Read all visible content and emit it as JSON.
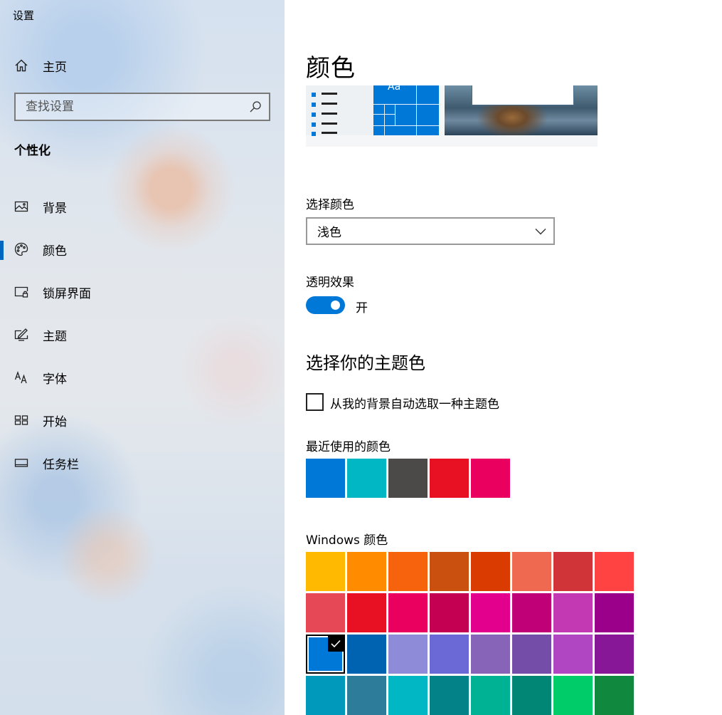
{
  "app": {
    "title": "设置"
  },
  "sidebar": {
    "home_label": "主页",
    "search_placeholder": "查找设置",
    "section_title": "个性化",
    "items": [
      {
        "label": "背景",
        "icon": "picture-icon",
        "active": false
      },
      {
        "label": "颜色",
        "icon": "palette-icon",
        "active": true
      },
      {
        "label": "锁屏界面",
        "icon": "lock-screen-icon",
        "active": false
      },
      {
        "label": "主题",
        "icon": "theme-brush-icon",
        "active": false
      },
      {
        "label": "字体",
        "icon": "font-icon",
        "active": false
      },
      {
        "label": "开始",
        "icon": "start-grid-icon",
        "active": false
      },
      {
        "label": "任务栏",
        "icon": "taskbar-icon",
        "active": false
      }
    ]
  },
  "main": {
    "title": "颜色",
    "preview_tile_text": "Aa",
    "choose_color_label": "选择颜色",
    "choose_color_value": "浅色",
    "transparency_label": "透明效果",
    "transparency_state": "开",
    "accent_heading": "选择你的主题色",
    "auto_accent_label": "从我的背景自动选取一种主题色",
    "recent_label": "最近使用的颜色",
    "windows_colors_label": "Windows 颜色"
  },
  "colors": {
    "accent": "#0078d7",
    "recent": [
      "#0078d7",
      "#00b7c3",
      "#4c4a48",
      "#e81123",
      "#ea005e"
    ],
    "windows": [
      "#ffb900",
      "#ff8c00",
      "#f7630c",
      "#ca5010",
      "#da3b01",
      "#ef6950",
      "#d13438",
      "#ff4343",
      "#e74856",
      "#e81123",
      "#ea005e",
      "#c30052",
      "#e3008c",
      "#bf0077",
      "#c239b3",
      "#9a0089",
      "#0078d7",
      "#0063b1",
      "#8e8cd8",
      "#6b69d6",
      "#8764b8",
      "#744da9",
      "#b146c2",
      "#881798",
      "#0099bc",
      "#2d7d9a",
      "#00b7c3",
      "#038387",
      "#00b294",
      "#018574",
      "#00cc6a",
      "#10893e"
    ],
    "selected_windows_index": 16
  }
}
